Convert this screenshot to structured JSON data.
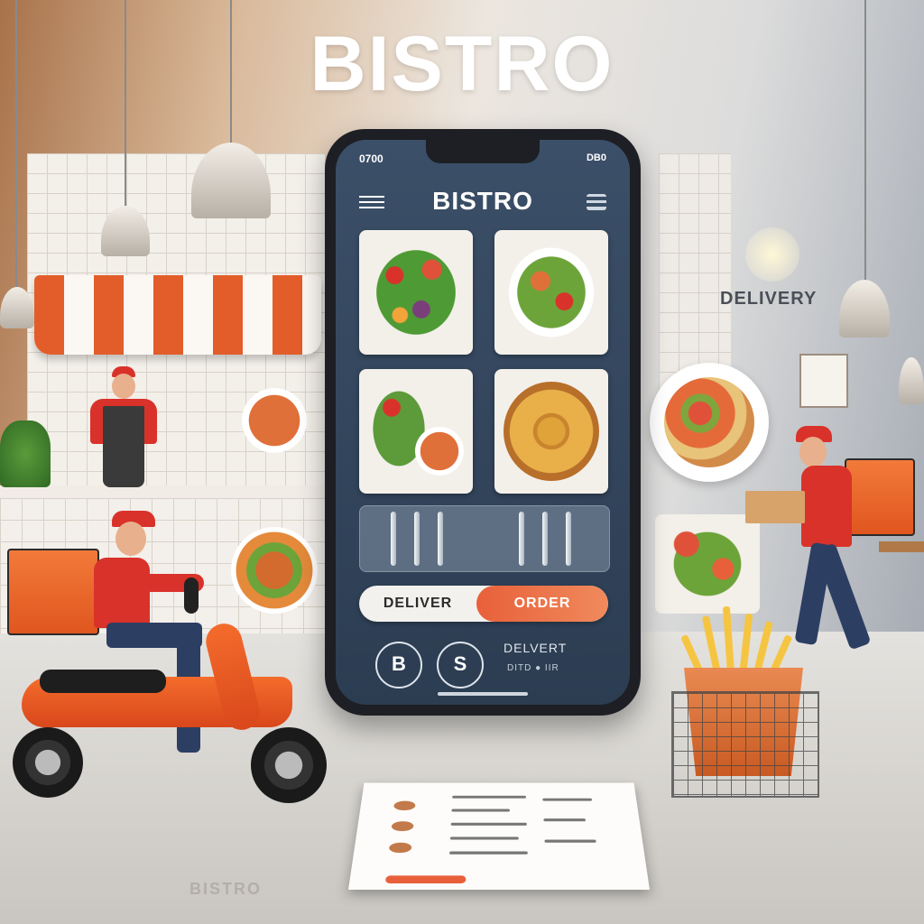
{
  "brand": {
    "title": "BISTRO"
  },
  "phone": {
    "status_time": "0700",
    "status_right": "DB0",
    "app_title": "BISTRO",
    "toggle": {
      "left_label": "DELIVER",
      "right_label": "ORDER"
    },
    "buttons": {
      "left_glyph": "B",
      "right_glyph": "S"
    },
    "delivery_line1": "DELVERT",
    "delivery_line2": "DITD ● IIR"
  },
  "signage": {
    "delivery": "DELIVERY"
  },
  "floor": {
    "text": "BISTRO"
  },
  "colors": {
    "accent": "#e8603a",
    "screen": "#34475e",
    "uniform": "#d9322a"
  }
}
